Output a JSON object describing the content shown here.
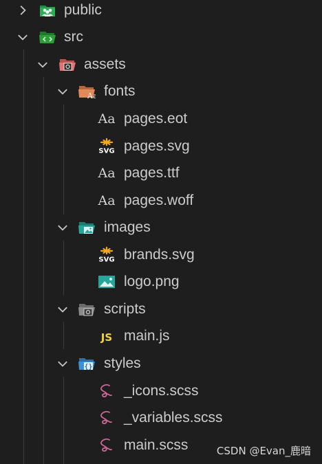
{
  "tree": {
    "items": [
      {
        "label": "public"
      },
      {
        "label": "src"
      },
      {
        "label": "assets"
      },
      {
        "label": "fonts"
      },
      {
        "label": "pages.eot"
      },
      {
        "label": "pages.svg"
      },
      {
        "label": "pages.ttf"
      },
      {
        "label": "pages.woff"
      },
      {
        "label": "images"
      },
      {
        "label": "brands.svg"
      },
      {
        "label": "logo.png"
      },
      {
        "label": "scripts"
      },
      {
        "label": "main.js"
      },
      {
        "label": "styles"
      },
      {
        "label": "_icons.scss"
      },
      {
        "label": "_variables.scss"
      },
      {
        "label": "main.scss"
      }
    ],
    "icon_text": {
      "font": "Aa",
      "svg": "SVG",
      "js": "JS"
    }
  },
  "watermark": "CSDN @Evan_鹿暗",
  "colors": {
    "background": "#1e1e1e",
    "text": "#cccccc",
    "public_folder": "#2fae5a",
    "src_folder": "#2f9c3a",
    "assets_folder": "#e57373",
    "fonts_folder": "#e08a5a",
    "images_folder": "#26a69a",
    "scripts_folder": "#8a8a8a",
    "styles_folder": "#3f8fd4",
    "sass": "#cd6799",
    "js": "#f2d53c",
    "svg_accent": "#f5a623"
  }
}
